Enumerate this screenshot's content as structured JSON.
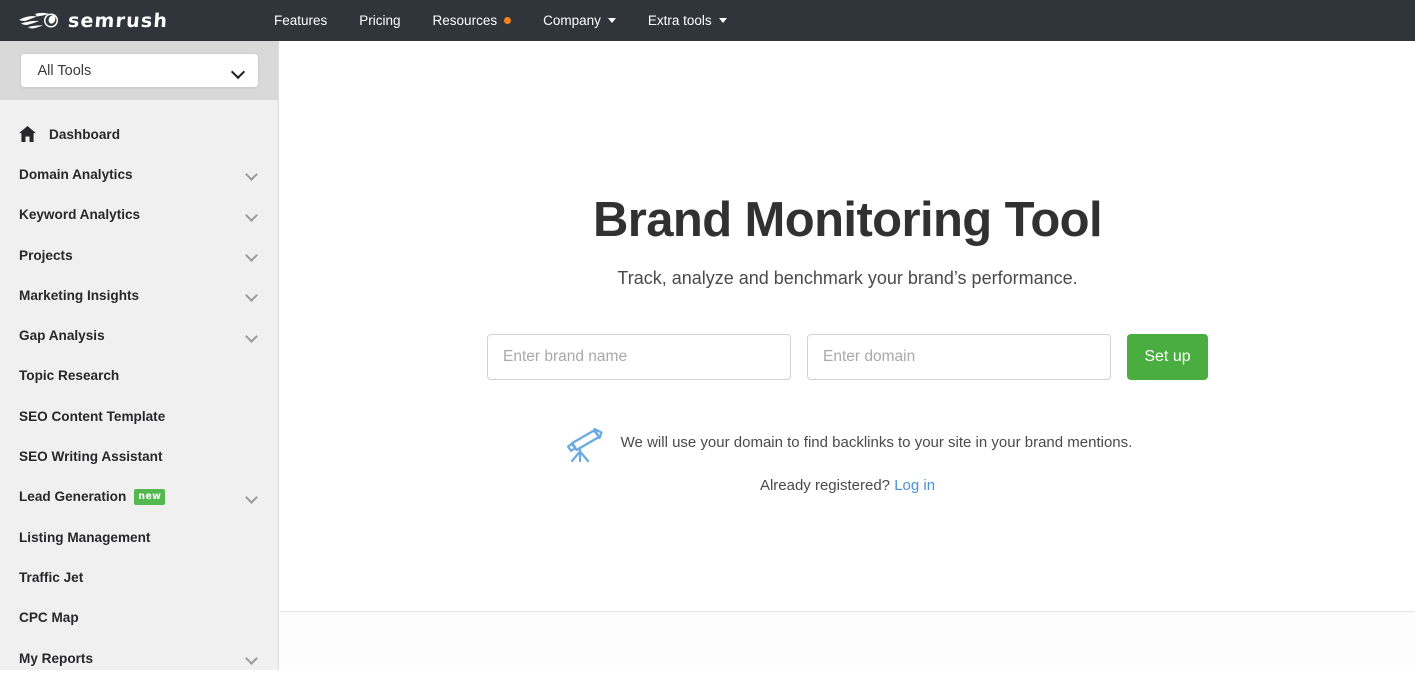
{
  "brand": {
    "logo_text": "semrush",
    "logo_icon": "semrush-comet-logo"
  },
  "topnav": {
    "items": [
      {
        "label": "Features",
        "has_dot": false,
        "has_caret": false
      },
      {
        "label": "Pricing",
        "has_dot": false,
        "has_caret": false
      },
      {
        "label": "Resources",
        "has_dot": true,
        "has_caret": false
      },
      {
        "label": "Company",
        "has_dot": false,
        "has_caret": true
      },
      {
        "label": "Extra tools",
        "has_dot": false,
        "has_caret": true
      }
    ],
    "dot_color": "#f5811f",
    "background": "#2f353b"
  },
  "sidebar": {
    "selector": {
      "label": "All Tools",
      "icon": "chevron-down-icon"
    },
    "items": [
      {
        "label": "Dashboard",
        "icon": "home-icon",
        "caret": false,
        "badge": null
      },
      {
        "label": "Domain Analytics",
        "icon": null,
        "caret": true,
        "badge": null
      },
      {
        "label": "Keyword Analytics",
        "icon": null,
        "caret": true,
        "badge": null
      },
      {
        "label": "Projects",
        "icon": null,
        "caret": true,
        "badge": null
      },
      {
        "label": "Marketing Insights",
        "icon": null,
        "caret": true,
        "badge": null
      },
      {
        "label": "Gap Analysis",
        "icon": null,
        "caret": true,
        "badge": null
      },
      {
        "label": "Topic Research",
        "icon": null,
        "caret": false,
        "badge": null
      },
      {
        "label": "SEO Content Template",
        "icon": null,
        "caret": false,
        "badge": null
      },
      {
        "label": "SEO Writing Assistant",
        "icon": null,
        "caret": false,
        "badge": null
      },
      {
        "label": "Lead Generation",
        "icon": null,
        "caret": true,
        "badge": "new"
      },
      {
        "label": "Listing Management",
        "icon": null,
        "caret": false,
        "badge": null
      },
      {
        "label": "Traffic Jet",
        "icon": null,
        "caret": false,
        "badge": null
      },
      {
        "label": "CPC Map",
        "icon": null,
        "caret": false,
        "badge": null
      },
      {
        "label": "My Reports",
        "icon": null,
        "caret": true,
        "badge": null
      }
    ],
    "badge_color": "#53b84e"
  },
  "hero": {
    "title": "Brand Monitoring Tool",
    "subtitle": "Track, analyze and benchmark your brand’s performance.",
    "form": {
      "brand_input": {
        "value": "",
        "placeholder": "Enter brand name"
      },
      "domain_input": {
        "value": "",
        "placeholder": "Enter domain"
      },
      "submit_label": "Set up",
      "submit_color": "#49ad3f"
    },
    "note": {
      "icon": "telescope-icon",
      "text": "We will use your domain to find backlinks to your site in your brand mentions."
    },
    "already": {
      "prefix": "Already registered? ",
      "link_label": "Log in",
      "link_color": "#4a90d9"
    }
  }
}
